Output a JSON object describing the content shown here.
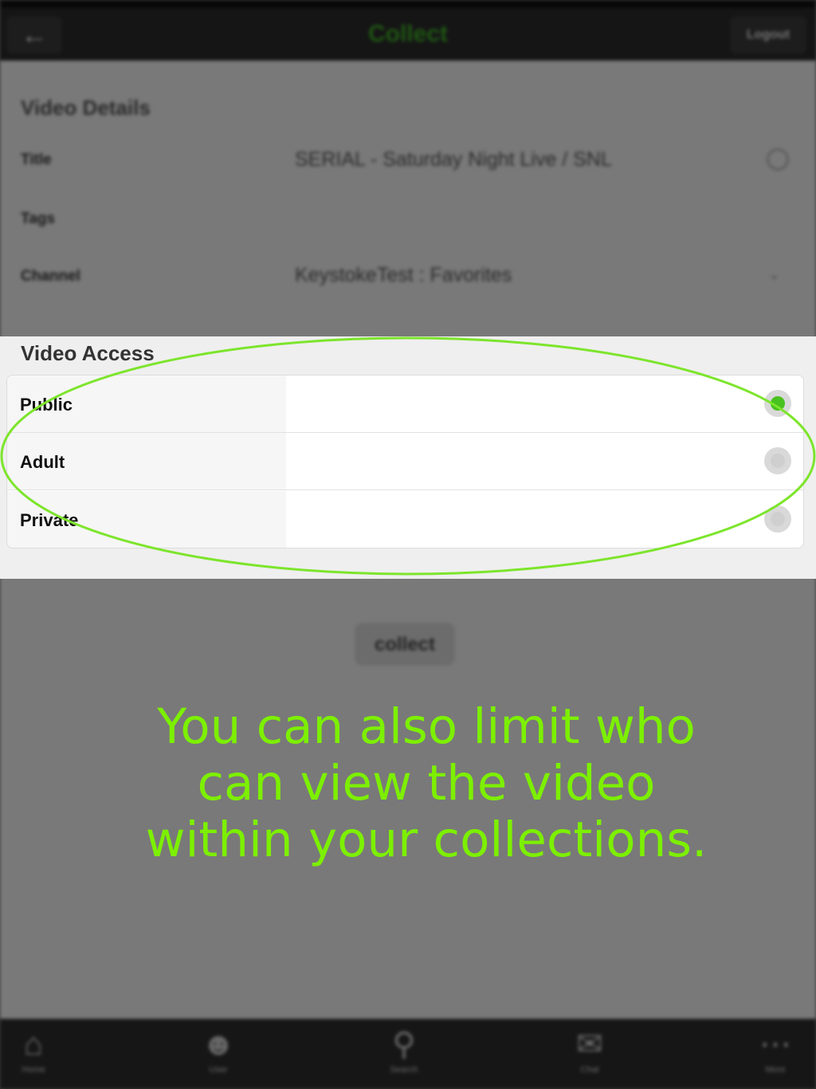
{
  "header": {
    "back_icon": "arrow-left-icon",
    "title": "Collect",
    "logout_label": "Logout"
  },
  "details": {
    "section_title": "Video Details",
    "rows": [
      {
        "label": "Title",
        "value": "SERIAL - Saturday Night Live / SNL"
      },
      {
        "label": "Tags",
        "value": ""
      },
      {
        "label": "Channel",
        "value": "KeystokeTest : Favorites"
      }
    ]
  },
  "access": {
    "section_title": "Video Access",
    "options": [
      {
        "label": "Public",
        "selected": true
      },
      {
        "label": "Adult",
        "selected": false
      },
      {
        "label": "Private",
        "selected": false
      }
    ]
  },
  "collect_button": "collect",
  "caption": {
    "line1": "You can also limit who",
    "line2": "can view the video",
    "line3": "within your collections."
  },
  "tabs": [
    {
      "label": "Home",
      "icon": "home-icon"
    },
    {
      "label": "User",
      "icon": "user-icon"
    },
    {
      "label": "Search",
      "icon": "search-icon"
    },
    {
      "label": "Chat",
      "icon": "chat-icon"
    },
    {
      "label": "More",
      "icon": "more-icon"
    }
  ],
  "colors": {
    "accent_green": "#49c21f",
    "caption_green": "#7cf000",
    "ellipse_green": "#7de52c"
  }
}
